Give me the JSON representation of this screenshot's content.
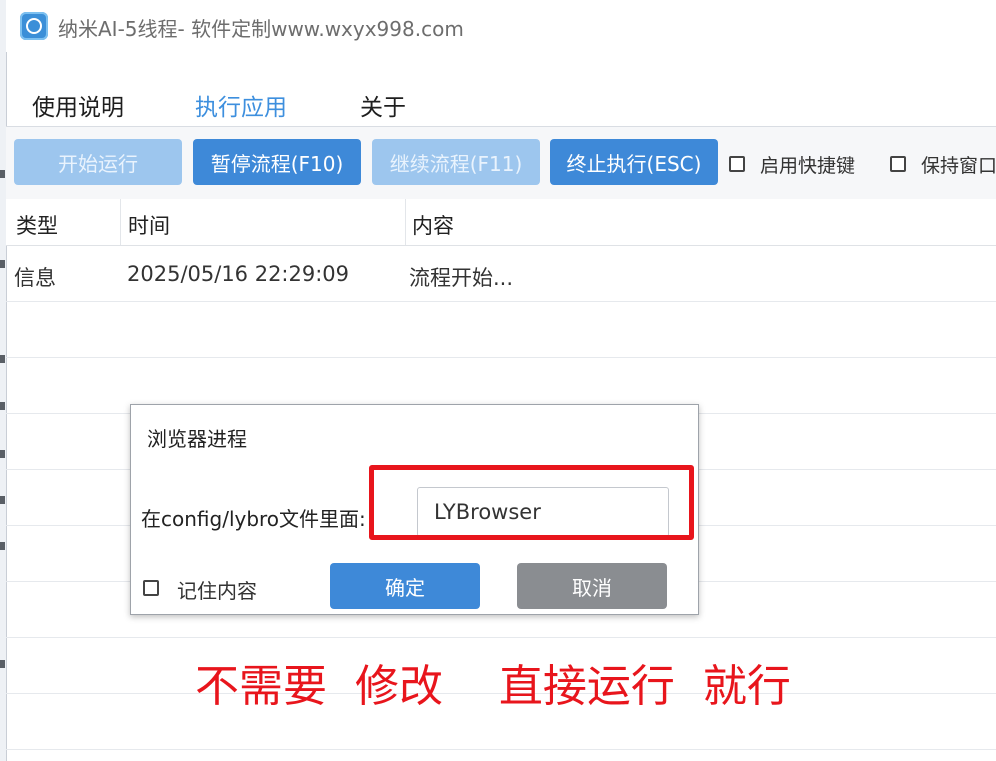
{
  "window": {
    "title": "纳米AI-5线程- 软件定制www.wxyx998.com"
  },
  "menu": [
    {
      "label": "使用说明",
      "active": false
    },
    {
      "label": "执行应用",
      "active": true
    },
    {
      "label": "关于",
      "active": false
    }
  ],
  "toolbar": {
    "start_label": "开始运行",
    "pause_label": "暂停流程(F10)",
    "continue_label": "继续流程(F11)",
    "stop_label": "终止执行(ESC)",
    "hotkey_checkbox_label": "启用快捷键",
    "keep_window_checkbox_label": "保持窗口"
  },
  "log_table": {
    "columns": [
      "类型",
      "时间",
      "内容"
    ],
    "rows": [
      {
        "type": "信息",
        "time": "2025/05/16 22:29:09",
        "content": "流程开始..."
      }
    ]
  },
  "dialog": {
    "title": "浏览器进程",
    "field_label": "在config/lybro文件里面:",
    "field_value": "LYBrowser",
    "remember_label": "记住内容",
    "ok_label": "确定",
    "cancel_label": "取消"
  },
  "annotation": {
    "text": "不需要  修改    直接运行  就行",
    "color": "#e8151c"
  },
  "colors": {
    "accent": "#3e89d8",
    "accent_disabled": "#9dc6ee",
    "cancel_gray": "#8a8d91",
    "annotation_red": "#e8151c"
  }
}
